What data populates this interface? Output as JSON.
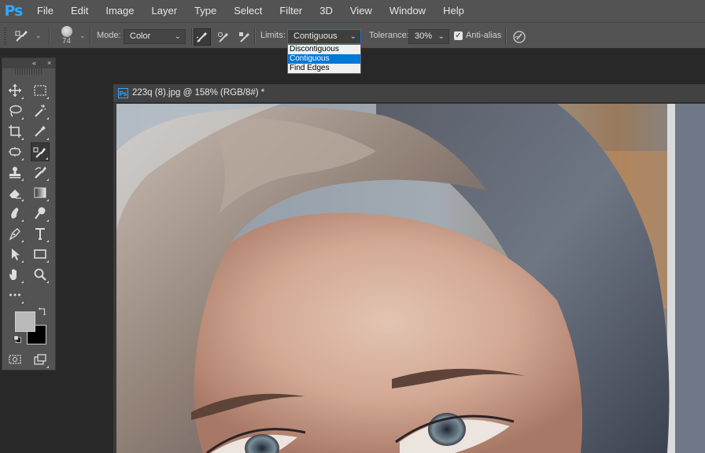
{
  "app": {
    "logo": "Ps"
  },
  "menu": [
    "File",
    "Edit",
    "Image",
    "Layer",
    "Type",
    "Select",
    "Filter",
    "3D",
    "View",
    "Window",
    "Help"
  ],
  "options": {
    "brush_size": "74",
    "mode_label": "Mode:",
    "mode_value": "Color",
    "limits_label": "Limits:",
    "limits_value": "Contiguous",
    "tolerance_label": "Tolerance:",
    "tolerance_value": "30%",
    "antialias_label": "Anti-alias",
    "antialias_checked": true
  },
  "limits_dropdown": {
    "options": [
      "Discontiguous",
      "Contiguous",
      "Find Edges"
    ],
    "selected": "Contiguous",
    "highlight_color": "#0078d7"
  },
  "tools_panel": {
    "collapse_glyph": "«",
    "close_glyph": "×",
    "tools": [
      "move-tool",
      "marquee-tool",
      "lasso-tool",
      "magic-wand-tool",
      "crop-tool",
      "eyedropper-tool",
      "healing-brush-tool",
      "color-replacement-tool",
      "clone-stamp-tool",
      "history-brush-tool",
      "eraser-tool",
      "gradient-tool",
      "smudge-tool",
      "dodge-tool",
      "pen-tool",
      "type-tool",
      "path-selection-tool",
      "rectangle-tool",
      "hand-tool",
      "zoom-tool",
      "more-tools",
      "swap-colors",
      "default-colors",
      "quick-mask",
      "screen-mode"
    ],
    "foreground_color": "#b9b9b9",
    "background_color": "#000000"
  },
  "document": {
    "icon": "Ps",
    "title": "223q (8).jpg @ 158% (RGB/8#) *"
  },
  "colors": {
    "ui_panel": "#535353",
    "workspace": "#282828",
    "brand_blue": "#31a8ff"
  }
}
